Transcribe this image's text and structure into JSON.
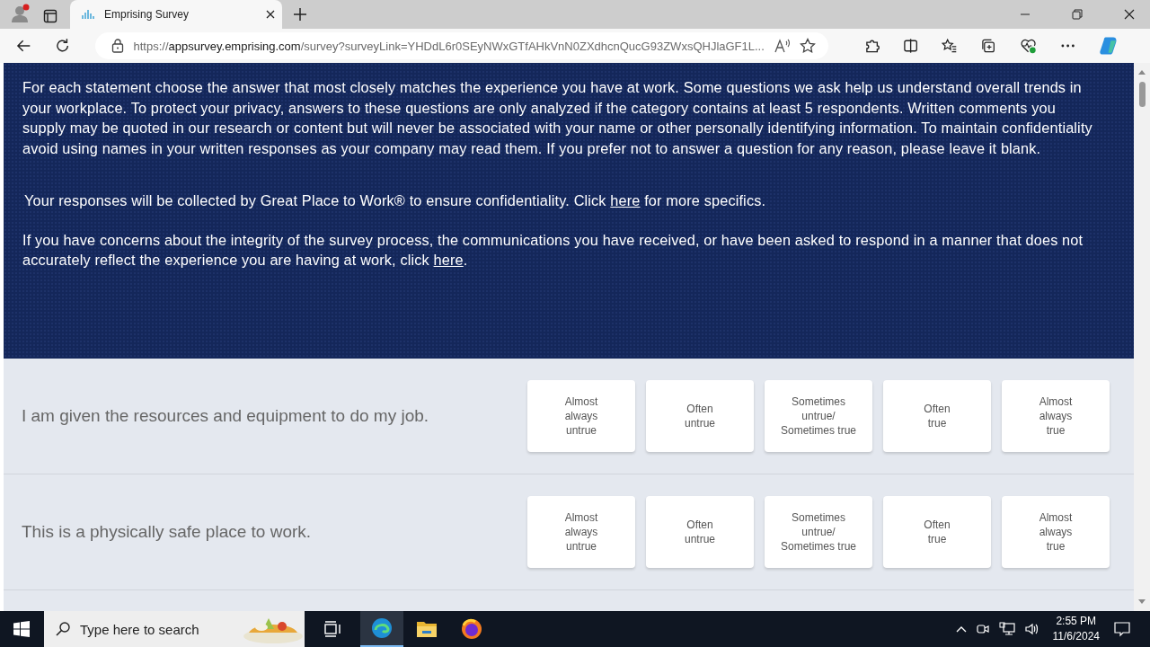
{
  "browser": {
    "tab": {
      "title": "Emprising Survey",
      "selected": true
    },
    "address": {
      "scheme": "https://",
      "host": "appsurvey.emprising.com",
      "path": "/survey?surveyLink=YHDdL6r0SEyNWxGTfAHkVnN0ZXdhcnQucG93ZWxsQHJlaGF1L..."
    }
  },
  "banner": {
    "paragraphs": [
      {
        "before": "For each statement choose the answer that most closely matches the experience you have at work. Some questions we ask help us understand overall trends in your workplace. To protect your privacy, answers to these questions are only analyzed if the category contains at least 5 respondents. Written comments you supply may be quoted in our research or content but will never be associated with your name or other personally identifying information. To maintain confidentiality avoid using names in your written responses as your company may read them. If you prefer not to answer a question for any reason, please leave it blank."
      },
      {
        "before": "Your responses will be collected by Great Place to Work® to ensure confidentiality. Click ",
        "link": "here",
        "after": " for more specifics."
      },
      {
        "before": "If you have concerns about the integrity of the survey process, the communications you have received, or have been asked to respond in a manner that does not accurately reflect the experience you are having at work, click ",
        "link": "here",
        "after": "."
      }
    ]
  },
  "questions": [
    {
      "text": "I am given the resources and equipment to do my job.",
      "options": [
        {
          "label": "Almost\nalways\nuntrue",
          "selected": false
        },
        {
          "label": "Often\nuntrue",
          "selected": false
        },
        {
          "label": "Sometimes\nuntrue/\nSometimes true",
          "selected": false
        },
        {
          "label": "Often\ntrue",
          "selected": false
        },
        {
          "label": "Almost\nalways\ntrue",
          "selected": false
        }
      ]
    },
    {
      "text": "This is a physically safe place to work.",
      "options": [
        {
          "label": "Almost\nalways\nuntrue",
          "selected": false
        },
        {
          "label": "Often\nuntrue",
          "selected": false
        },
        {
          "label": "Sometimes\nuntrue/\nSometimes true",
          "selected": false
        },
        {
          "label": "Often\ntrue",
          "selected": false
        },
        {
          "label": "Almost\nalways\ntrue",
          "selected": false
        }
      ]
    }
  ],
  "taskbar": {
    "search": {
      "placeholder": "Type here to search"
    },
    "time": "2:55 PM",
    "date": "11/6/2024"
  }
}
